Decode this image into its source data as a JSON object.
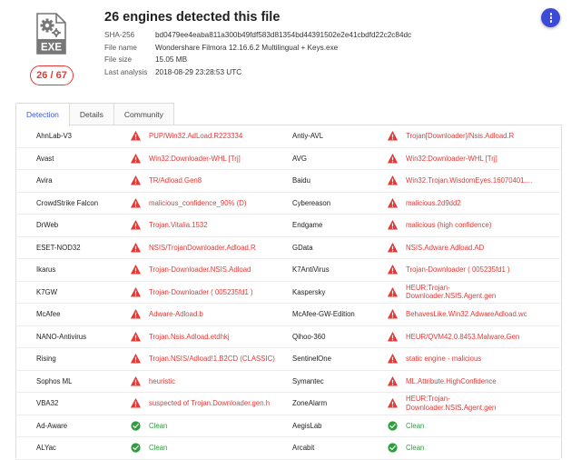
{
  "header": {
    "title": "26 engines detected this file",
    "score": "26 / 67",
    "file_icon_label": "EXE",
    "meta": [
      {
        "key": "SHA-256",
        "value": "bd0479ee4eaba811a300b49fdf583d81354bd44391502e2e41cbdfd22c2c84dc"
      },
      {
        "key": "File name",
        "value": "Wondershare Filmora 12.16.6.2 Multilingual + Keys.exe"
      },
      {
        "key": "File size",
        "value": "15.05 MB"
      },
      {
        "key": "Last analysis",
        "value": "2018-08-29 23:28:53 UTC"
      }
    ]
  },
  "tabs": [
    {
      "label": "Detection",
      "active": true
    },
    {
      "label": "Details",
      "active": false
    },
    {
      "label": "Community",
      "active": false
    }
  ],
  "colors": {
    "malicious": "#e53935",
    "clean": "#2e9e3e",
    "accent": "#3b4bd8"
  },
  "icons": {
    "malicious": "alert-triangle-icon",
    "clean": "check-circle-icon",
    "menu": "more-vert-icon"
  },
  "rows": [
    {
      "left": {
        "engine": "AhnLab-V3",
        "result": "PUP/Win32.AdLoad.R223334",
        "status": "malicious"
      },
      "right": {
        "engine": "Antiy-AVL",
        "result": "Trojan[Downloader]/Nsis.Adload.R",
        "status": "malicious"
      }
    },
    {
      "left": {
        "engine": "Avast",
        "result": "Win32:Downloader-WHL [Trj]",
        "status": "malicious"
      },
      "right": {
        "engine": "AVG",
        "result": "Win32:Downloader-WHL [Trj]",
        "status": "malicious"
      }
    },
    {
      "left": {
        "engine": "Avira",
        "result": "TR/Adload.Gen8",
        "status": "malicious"
      },
      "right": {
        "engine": "Baidu",
        "result": "Win32.Trojan.WisdomEyes.16070401....",
        "status": "malicious"
      }
    },
    {
      "left": {
        "engine": "CrowdStrike Falcon",
        "result": "malicious_confidence_90% (D)",
        "status": "malicious"
      },
      "right": {
        "engine": "Cybereason",
        "result": "malicious.2d9dd2",
        "status": "malicious"
      }
    },
    {
      "left": {
        "engine": "DrWeb",
        "result": "Trojan.Vitalia.1532",
        "status": "malicious"
      },
      "right": {
        "engine": "Endgame",
        "result": "malicious (high confidence)",
        "status": "malicious"
      }
    },
    {
      "left": {
        "engine": "ESET-NOD32",
        "result": "NSIS/TrojanDownloader.Adload.R",
        "status": "malicious"
      },
      "right": {
        "engine": "GData",
        "result": "NSIS.Adware.Adload.AD",
        "status": "malicious"
      }
    },
    {
      "left": {
        "engine": "Ikarus",
        "result": "Trojan-Downloader.NSIS.Adload",
        "status": "malicious"
      },
      "right": {
        "engine": "K7AntiVirus",
        "result": "Trojan-Downloader ( 005235fd1 )",
        "status": "malicious"
      }
    },
    {
      "left": {
        "engine": "K7GW",
        "result": "Trojan-Downloader ( 005235fd1 )",
        "status": "malicious"
      },
      "right": {
        "engine": "Kaspersky",
        "result": "HEUR:Trojan-Downloader.NSIS.Agent.gen",
        "result_lines": [
          "HEUR:Trojan-",
          "Downloader.NSIS.Agent.gen"
        ],
        "status": "malicious"
      }
    },
    {
      "left": {
        "engine": "McAfee",
        "result": "Adware-Adload.b",
        "status": "malicious"
      },
      "right": {
        "engine": "McAfee-GW-Edition",
        "result": "BehavesLike.Win32.AdwareAdload.wc",
        "status": "malicious"
      }
    },
    {
      "left": {
        "engine": "NANO-Antivirus",
        "result": "Trojan.Nsis.Adload.etdhkj",
        "status": "malicious"
      },
      "right": {
        "engine": "Qihoo-360",
        "result": "HEUR/QVM42.0.8453.Malware.Gen",
        "status": "malicious"
      }
    },
    {
      "left": {
        "engine": "Rising",
        "result": "Trojan.NSIS/Adload!1.B2CD (CLASSIC)",
        "status": "malicious"
      },
      "right": {
        "engine": "SentinelOne",
        "result": "static engine - malicious",
        "status": "malicious"
      }
    },
    {
      "left": {
        "engine": "Sophos ML",
        "result": "heuristic",
        "status": "malicious"
      },
      "right": {
        "engine": "Symantec",
        "result": "ML.Attribute.HighConfidence",
        "status": "malicious"
      }
    },
    {
      "left": {
        "engine": "VBA32",
        "result": "suspected of Trojan.Downloader.gen.h",
        "status": "malicious"
      },
      "right": {
        "engine": "ZoneAlarm",
        "result": "HEUR:Trojan-Downloader.NSIS.Agent.gen",
        "result_lines": [
          "HEUR:Trojan-",
          "Downloader.NSIS.Agent.gen"
        ],
        "status": "malicious"
      }
    },
    {
      "left": {
        "engine": "Ad-Aware",
        "result": "Clean",
        "status": "clean"
      },
      "right": {
        "engine": "AegisLab",
        "result": "Clean",
        "status": "clean"
      }
    },
    {
      "left": {
        "engine": "ALYac",
        "result": "Clean",
        "status": "clean"
      },
      "right": {
        "engine": "Arcabit",
        "result": "Clean",
        "status": "clean"
      }
    }
  ]
}
